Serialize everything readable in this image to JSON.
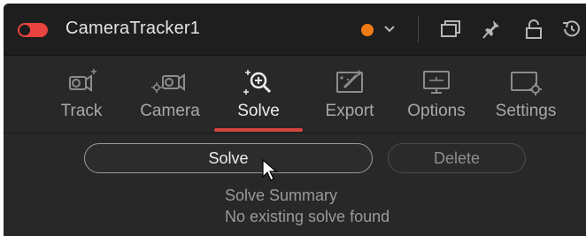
{
  "header": {
    "title": "CameraTracker1",
    "toggle_state": "on",
    "accent_color": "#e9443f",
    "color_dot": "#f07b14",
    "icons": [
      "chevron-down-icon",
      "window-icon",
      "pin-icon",
      "lock-icon",
      "reset-icon"
    ]
  },
  "tabs": [
    {
      "label": "Track",
      "icon": "track-camera-icon"
    },
    {
      "label": "Camera",
      "icon": "camera-icon"
    },
    {
      "label": "Solve",
      "icon": "solve-icon",
      "active": true
    },
    {
      "label": "Export",
      "icon": "export-icon"
    },
    {
      "label": "Options",
      "icon": "monitor-icon"
    },
    {
      "label": "Settings",
      "icon": "settings-icon"
    }
  ],
  "actions": {
    "solve_label": "Solve",
    "delete_label": "Delete"
  },
  "summary": {
    "title": "Solve Summary",
    "status": "No existing solve found"
  }
}
